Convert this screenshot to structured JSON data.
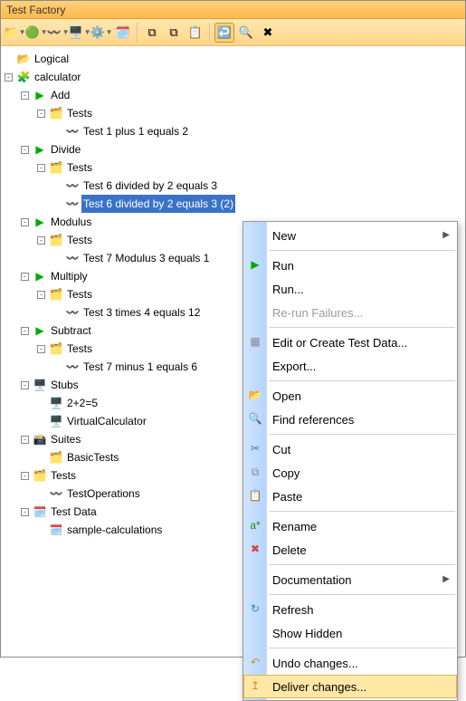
{
  "window": {
    "title": "Test Factory"
  },
  "toolbar": {
    "buttons": [
      {
        "name": "folder-icon",
        "glyph": "📁",
        "dd": true
      },
      {
        "name": "new-icon",
        "glyph": "🟢",
        "dd": true
      },
      {
        "name": "wave-icon",
        "glyph": "〰️",
        "dd": true
      },
      {
        "name": "monitor-icon",
        "glyph": "🖥️",
        "dd": true
      },
      {
        "name": "gear-icon",
        "glyph": "⚙️",
        "dd": true
      },
      {
        "name": "calc-icon",
        "glyph": "🗓️",
        "dd": false
      }
    ],
    "buttons2": [
      {
        "name": "copy-icon",
        "glyph": "⧉"
      },
      {
        "name": "clone-icon",
        "glyph": "⧉"
      },
      {
        "name": "paste-icon",
        "glyph": "📋"
      }
    ],
    "buttons3": [
      {
        "name": "deliver-icon",
        "glyph": "↩️",
        "active": true
      },
      {
        "name": "search-icon",
        "glyph": "🔍"
      },
      {
        "name": "delete-icon",
        "glyph": "✖"
      }
    ]
  },
  "tree": {
    "root": "Logical",
    "project": "calculator",
    "ops": [
      {
        "name": "Add",
        "tests_label": "Tests",
        "items": [
          "Test 1 plus 1 equals 2"
        ]
      },
      {
        "name": "Divide",
        "tests_label": "Tests",
        "items": [
          "Test 6 divided by  2 equals 3",
          "Test 6 divided by  2 equals 3 (2)"
        ],
        "selected_index": 1
      },
      {
        "name": "Modulus",
        "tests_label": "Tests",
        "items": [
          "Test 7 Modulus 3 equals 1"
        ]
      },
      {
        "name": "Multiply",
        "tests_label": "Tests",
        "items": [
          "Test 3 times 4 equals 12"
        ]
      },
      {
        "name": "Subtract",
        "tests_label": "Tests",
        "items": [
          "Test 7 minus 1 equals 6"
        ]
      }
    ],
    "stubs": {
      "label": "Stubs",
      "items": [
        "2+2=5",
        "VirtualCalculator"
      ]
    },
    "suites": {
      "label": "Suites",
      "items": [
        "BasicTests"
      ]
    },
    "tests": {
      "label": "Tests",
      "items": [
        "TestOperations"
      ]
    },
    "testdata": {
      "label": "Test Data",
      "items": [
        "sample-calculations"
      ]
    }
  },
  "menu": {
    "items": [
      {
        "label": "New",
        "submenu": true
      },
      {
        "sep": true
      },
      {
        "label": "Run",
        "icon": "▶",
        "iconColor": "#0a0"
      },
      {
        "label": "Run..."
      },
      {
        "label": "Re-run Failures...",
        "disabled": true
      },
      {
        "sep": true
      },
      {
        "label": "Edit or Create Test Data...",
        "icon": "▦",
        "iconColor": "#888"
      },
      {
        "label": "Export..."
      },
      {
        "sep": true
      },
      {
        "label": "Open",
        "icon": "📂"
      },
      {
        "label": "Find references",
        "icon": "🔍"
      },
      {
        "sep": true
      },
      {
        "label": "Cut",
        "icon": "✂",
        "iconColor": "#2a7fd4"
      },
      {
        "label": "Copy",
        "icon": "⧉",
        "iconColor": "#888"
      },
      {
        "label": "Paste",
        "icon": "📋"
      },
      {
        "sep": true
      },
      {
        "label": "Rename",
        "icon": "a*",
        "iconColor": "#1a8a1a"
      },
      {
        "label": "Delete",
        "icon": "✖",
        "iconColor": "#d43"
      },
      {
        "sep": true
      },
      {
        "label": "Documentation",
        "submenu": true
      },
      {
        "sep": true
      },
      {
        "label": "Refresh",
        "icon": "↻",
        "iconColor": "#2a7fd4"
      },
      {
        "label": "Show Hidden"
      },
      {
        "sep": true
      },
      {
        "label": "Undo changes...",
        "icon": "↶",
        "iconColor": "#d48a2a"
      },
      {
        "label": "Deliver changes...",
        "icon": "↥",
        "iconColor": "#d48a2a",
        "hover": true
      }
    ]
  }
}
